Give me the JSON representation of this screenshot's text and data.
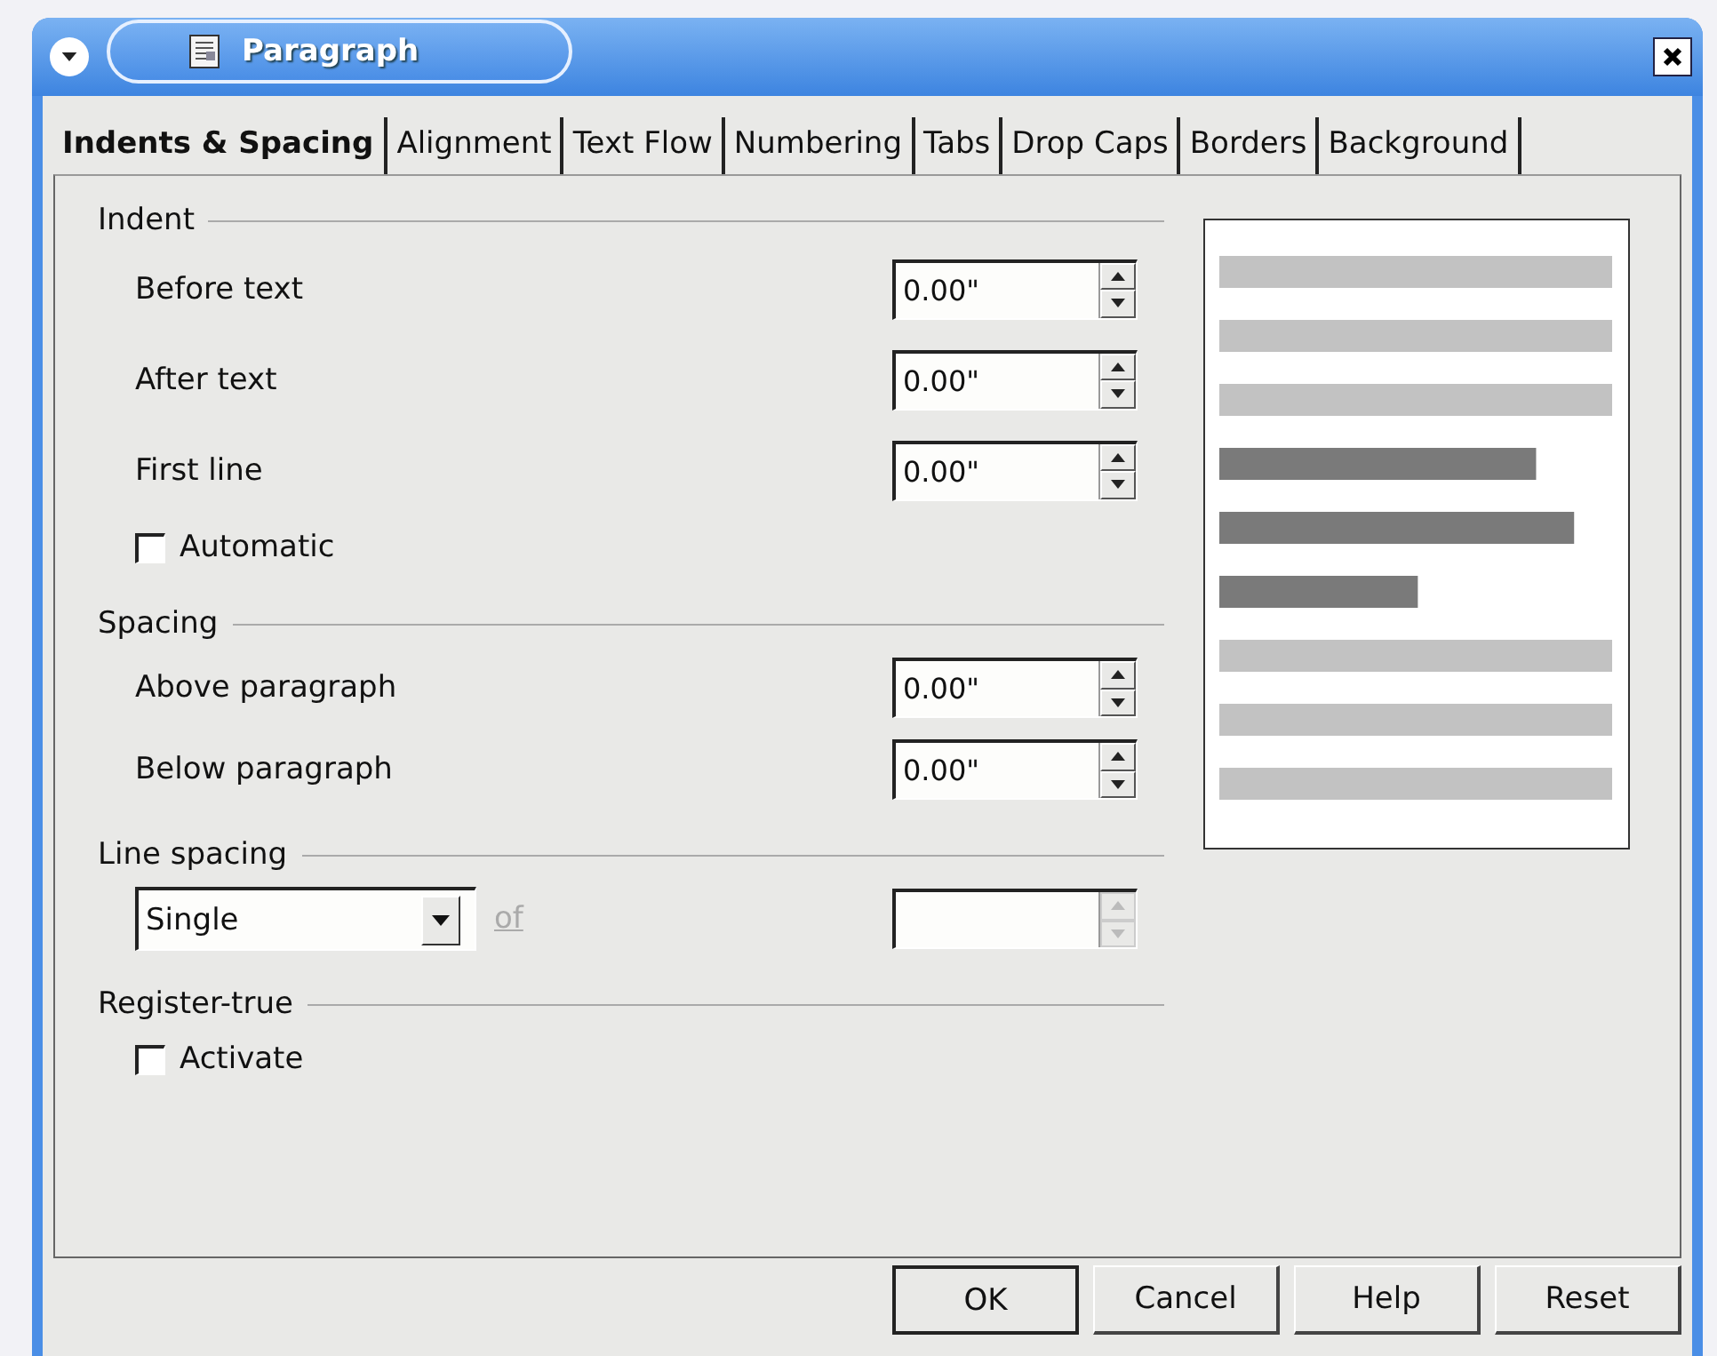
{
  "window": {
    "title": "Paragraph"
  },
  "tabs": [
    {
      "label": "Indents & Spacing",
      "selected": true
    },
    {
      "label": "Alignment",
      "selected": false
    },
    {
      "label": "Text Flow",
      "selected": false
    },
    {
      "label": "Numbering",
      "selected": false
    },
    {
      "label": "Tabs",
      "selected": false
    },
    {
      "label": "Drop Caps",
      "selected": false
    },
    {
      "label": "Borders",
      "selected": false
    },
    {
      "label": "Background",
      "selected": false
    }
  ],
  "groups": [
    {
      "title": "Indent",
      "items": [
        {
          "kind": "spin",
          "label": "Before text",
          "value": "0.00\""
        },
        {
          "kind": "spin",
          "label": "After text",
          "value": "0.00\""
        },
        {
          "kind": "spin",
          "label": "First line",
          "value": "0.00\""
        },
        {
          "kind": "checkbox",
          "label": "Automatic",
          "checked": false
        }
      ]
    },
    {
      "title": "Spacing",
      "items": [
        {
          "kind": "spin",
          "label": "Above paragraph",
          "value": "0.00\""
        },
        {
          "kind": "spin",
          "label": "Below paragraph",
          "value": "0.00\""
        }
      ]
    },
    {
      "title": "Line spacing",
      "items": [
        {
          "kind": "select",
          "value": "Single",
          "of_label": "of",
          "spin_disabled": true
        }
      ]
    },
    {
      "title": "Register-true",
      "items": [
        {
          "kind": "checkbox",
          "label": "Activate",
          "checked": false
        }
      ]
    }
  ],
  "buttons": [
    {
      "label": "OK",
      "default": true
    },
    {
      "label": "Cancel",
      "default": false
    },
    {
      "label": "Help",
      "default": false
    },
    {
      "label": "Reset",
      "default": false
    }
  ]
}
